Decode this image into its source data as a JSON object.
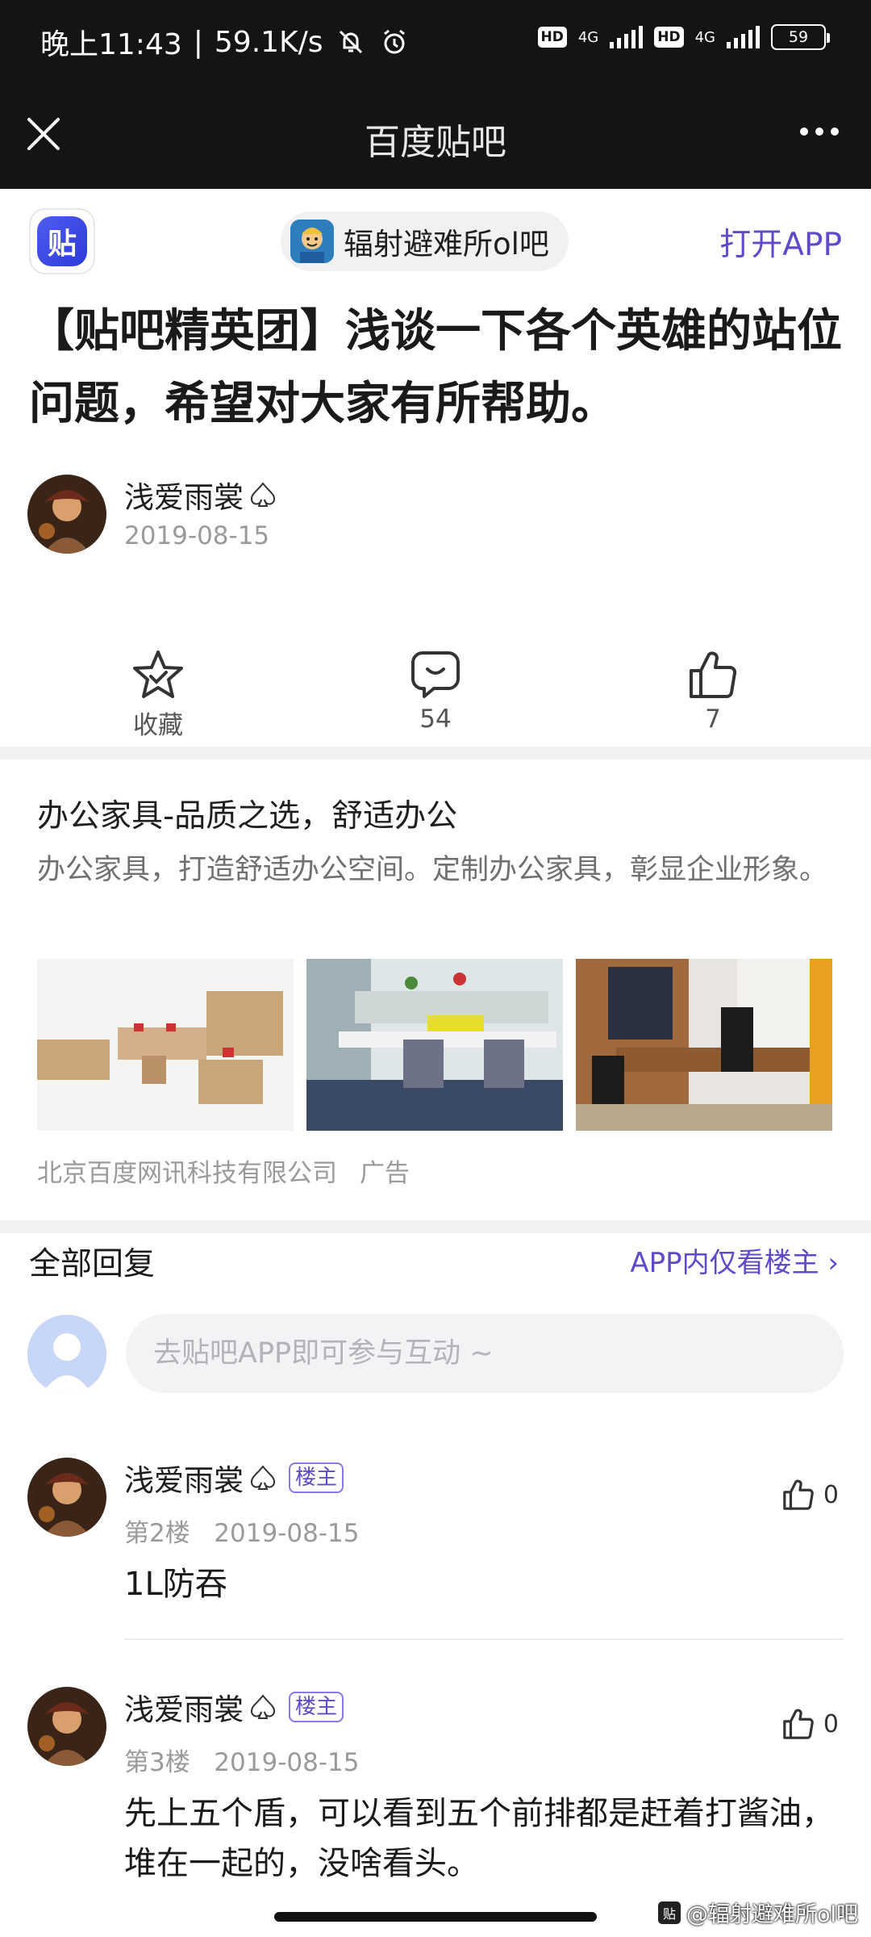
{
  "status_bar": {
    "time": "晚上11:43",
    "separator": "|",
    "speed": "59.1K/s",
    "hd1": "HD",
    "net1": "4G",
    "hd2": "HD",
    "net2": "4G",
    "battery": "59"
  },
  "title_bar": {
    "title": "百度贴吧"
  },
  "forum": {
    "logo_char": "贴",
    "name": "辐射避难所ol吧",
    "open_app": "打开APP"
  },
  "post": {
    "title": "【贴吧精英团】浅谈一下各个英雄的站位问题，希望对大家有所帮助。",
    "author": "浅爱雨裳",
    "date": "2019-08-15"
  },
  "actions": {
    "collect": "收藏",
    "comments": "54",
    "likes": "7"
  },
  "ad": {
    "title": "办公家具-品质之选，舒适办公",
    "desc": "办公家具，打造舒适办公空间。定制办公家具，彰显企业形象。",
    "company": "北京百度网讯科技有限公司",
    "tag": "广告"
  },
  "replies": {
    "header": "全部回复",
    "op_only": "APP内仅看楼主 ›",
    "input_placeholder": "去贴吧APP即可参与互动 ~",
    "items": [
      {
        "author": "浅爱雨裳",
        "badge": "楼主",
        "floor": "第2楼",
        "date": "2019-08-15",
        "likes": "0",
        "text": "1L防吞"
      },
      {
        "author": "浅爱雨裳",
        "badge": "楼主",
        "floor": "第3楼",
        "date": "2019-08-15",
        "likes": "0",
        "text": "先上五个盾，可以看到五个前排都是赶着打酱油，堆在一起的，没啥看头。"
      }
    ]
  },
  "watermark": {
    "box": "贴",
    "text": "@辐射避难所ol吧"
  },
  "colors": {
    "accent": "#6149c9",
    "dark_bar": "#141414",
    "band": "#f2f2f5"
  }
}
